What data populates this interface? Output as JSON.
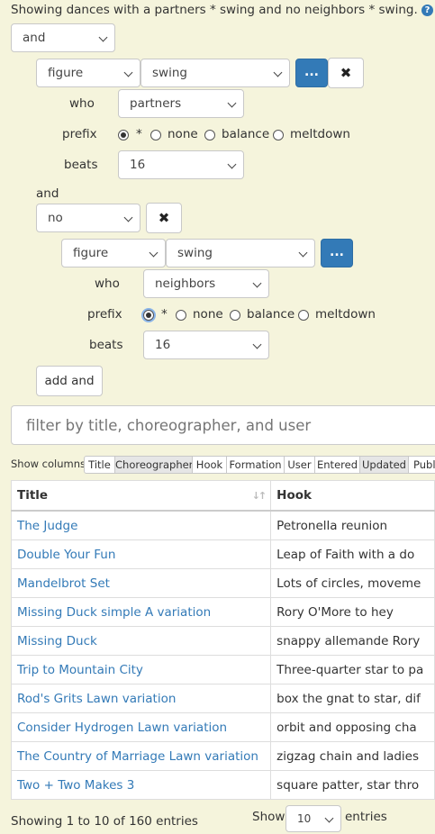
{
  "header": {
    "summary": "Showing dances with a partners * swing and no neighbors * swing."
  },
  "filter": {
    "root_op": "and",
    "clause1": {
      "type": "figure",
      "figure": "swing",
      "more_label": "...",
      "remove_label": "✖",
      "who_label": "who",
      "who": "partners",
      "prefix_label": "prefix",
      "prefix_options": [
        "*",
        "none",
        "balance",
        "meltdown"
      ],
      "prefix_selected": "*",
      "beats_label": "beats",
      "beats": "16"
    },
    "joiner_label": "and",
    "clause2": {
      "op": "no",
      "remove_label": "✖",
      "type": "figure",
      "figure": "swing",
      "more_label": "...",
      "who_label": "who",
      "who": "neighbors",
      "prefix_label": "prefix",
      "prefix_options": [
        "*",
        "none",
        "balance",
        "meltdown"
      ],
      "prefix_selected": "*",
      "beats_label": "beats",
      "beats": "16"
    },
    "add_and_label": "add and"
  },
  "search": {
    "placeholder": "filter by title, choreographer, and user"
  },
  "columns_toggle": {
    "label": "Show columns",
    "buttons": [
      "Title",
      "Choreographer",
      "Hook",
      "Formation",
      "User",
      "Entered",
      "Updated",
      "Publ"
    ],
    "active": [
      "Title",
      "Hook",
      "Formation",
      "User",
      "Entered",
      "Publ"
    ]
  },
  "table": {
    "headers": [
      "Title",
      "Hook"
    ],
    "rows": [
      {
        "title": "The Judge",
        "hook": "Petronella reunion"
      },
      {
        "title": "Double Your Fun",
        "hook": "Leap of Faith with a do"
      },
      {
        "title": "Mandelbrot Set",
        "hook": "Lots of circles, moveme"
      },
      {
        "title": "Missing Duck simple A variation",
        "hook": "Rory O'More to hey"
      },
      {
        "title": "Missing Duck",
        "hook": "snappy allemande Rory"
      },
      {
        "title": "Trip to Mountain City",
        "hook": "Three-quarter star to pa"
      },
      {
        "title": "Rod's Grits Lawn variation",
        "hook": "box the gnat to star, dif"
      },
      {
        "title": "Consider Hydrogen Lawn variation",
        "hook": "orbit and opposing cha"
      },
      {
        "title": "The Country of Marriage Lawn variation",
        "hook": "zigzag chain and ladies"
      },
      {
        "title": "Two + Two Makes 3",
        "hook": "square patter, star thro"
      }
    ]
  },
  "footer": {
    "info": "Showing 1 to 10 of 160 entries",
    "show_label": "Show",
    "page_size": "10",
    "entries_label": "entries"
  },
  "colors": {
    "background": "#f5f4dc",
    "link": "#337ab7",
    "primary_button": "#337ab7"
  }
}
